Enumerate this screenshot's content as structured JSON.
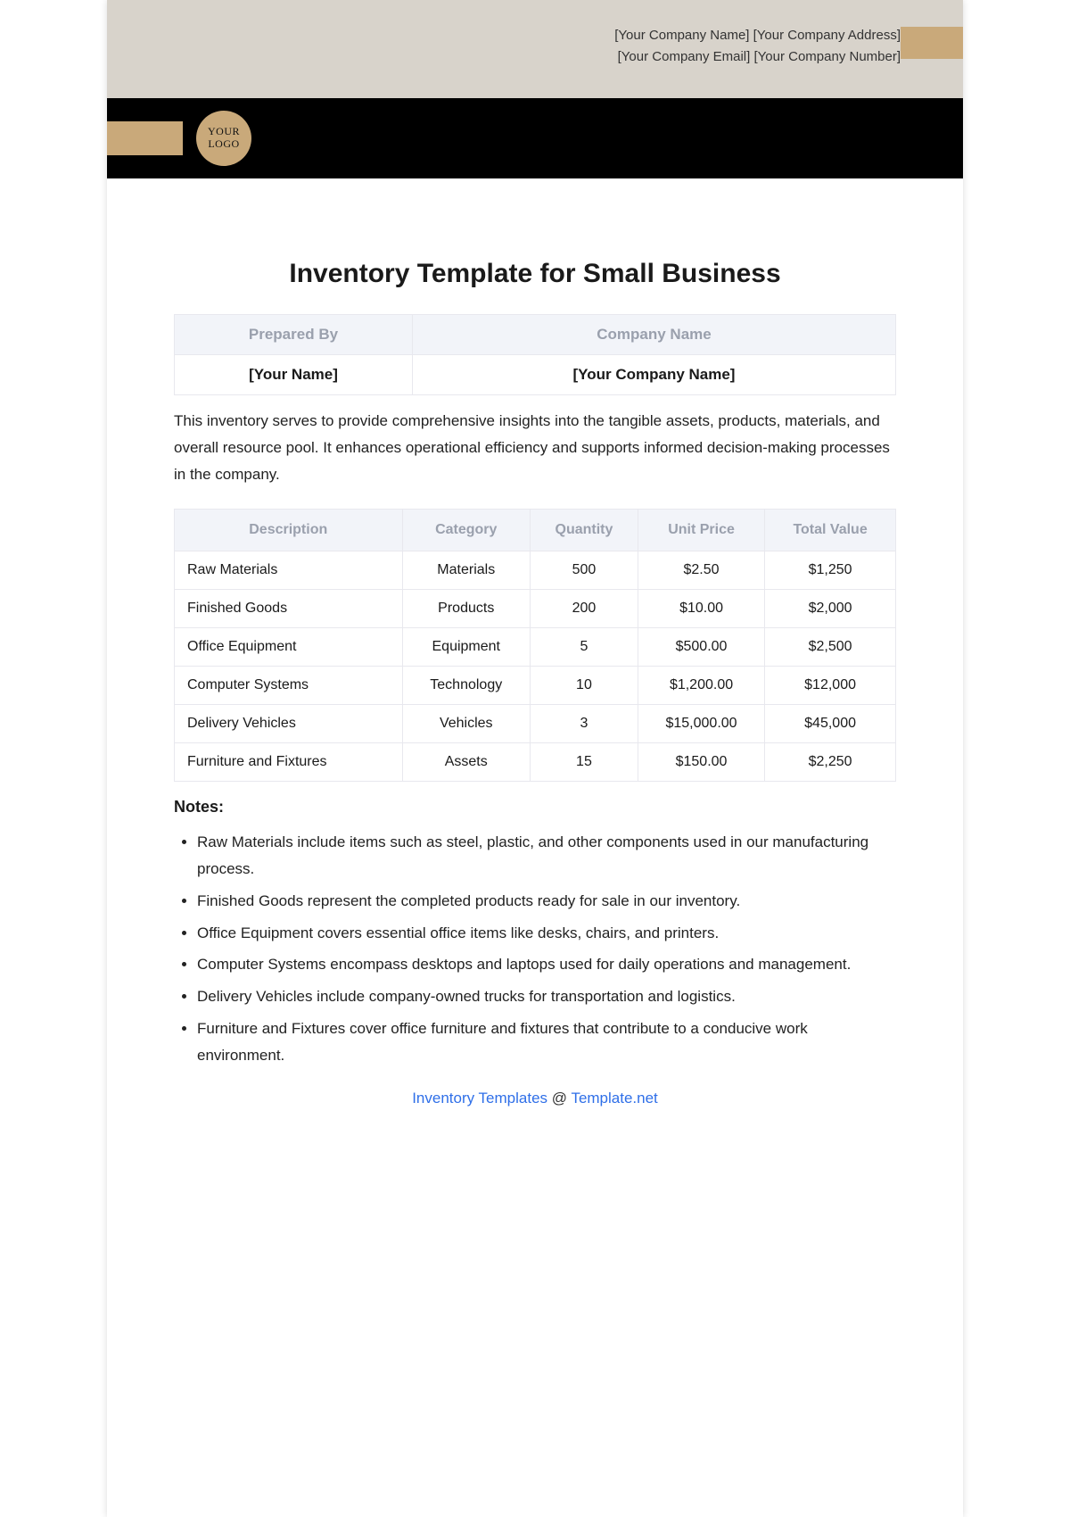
{
  "header": {
    "line1": "[Your Company Name] [Your Company Address]",
    "line2": "[Your Company Email] [Your Company Number]",
    "logo_line1": "YOUR",
    "logo_line2": "LOGO"
  },
  "title": "Inventory Template for Small Business",
  "meta_table": {
    "headers": [
      "Prepared By",
      "Company Name"
    ],
    "values": [
      "[Your Name]",
      "[Your Company Name]"
    ]
  },
  "intro": "This inventory serves to provide comprehensive insights into the tangible assets, products, materials, and overall resource pool. It enhances operational efficiency and supports informed decision-making processes in the company.",
  "inventory": {
    "headers": [
      "Description",
      "Category",
      "Quantity",
      "Unit Price",
      "Total Value"
    ],
    "rows": [
      [
        "Raw Materials",
        "Materials",
        "500",
        "$2.50",
        "$1,250"
      ],
      [
        "Finished Goods",
        "Products",
        "200",
        "$10.00",
        "$2,000"
      ],
      [
        "Office Equipment",
        "Equipment",
        "5",
        "$500.00",
        "$2,500"
      ],
      [
        "Computer Systems",
        "Technology",
        "10",
        "$1,200.00",
        "$12,000"
      ],
      [
        "Delivery Vehicles",
        "Vehicles",
        "3",
        "$15,000.00",
        "$45,000"
      ],
      [
        "Furniture and Fixtures",
        "Assets",
        "15",
        "$150.00",
        "$2,250"
      ]
    ]
  },
  "notes_heading": "Notes:",
  "notes": [
    "Raw Materials include items such as steel, plastic, and other components used in our manufacturing process.",
    "Finished Goods represent the completed products ready for sale in our inventory.",
    "Office Equipment covers essential office items like desks, chairs, and printers.",
    "Computer Systems encompass desktops and laptops used for daily operations and management.",
    "Delivery Vehicles include company-owned trucks for transportation and logistics.",
    "Furniture and Fixtures cover office furniture and fixtures that contribute to a conducive work environment."
  ],
  "footer": {
    "link1": "Inventory Templates",
    "at": " @ ",
    "link2": "Template.net"
  }
}
